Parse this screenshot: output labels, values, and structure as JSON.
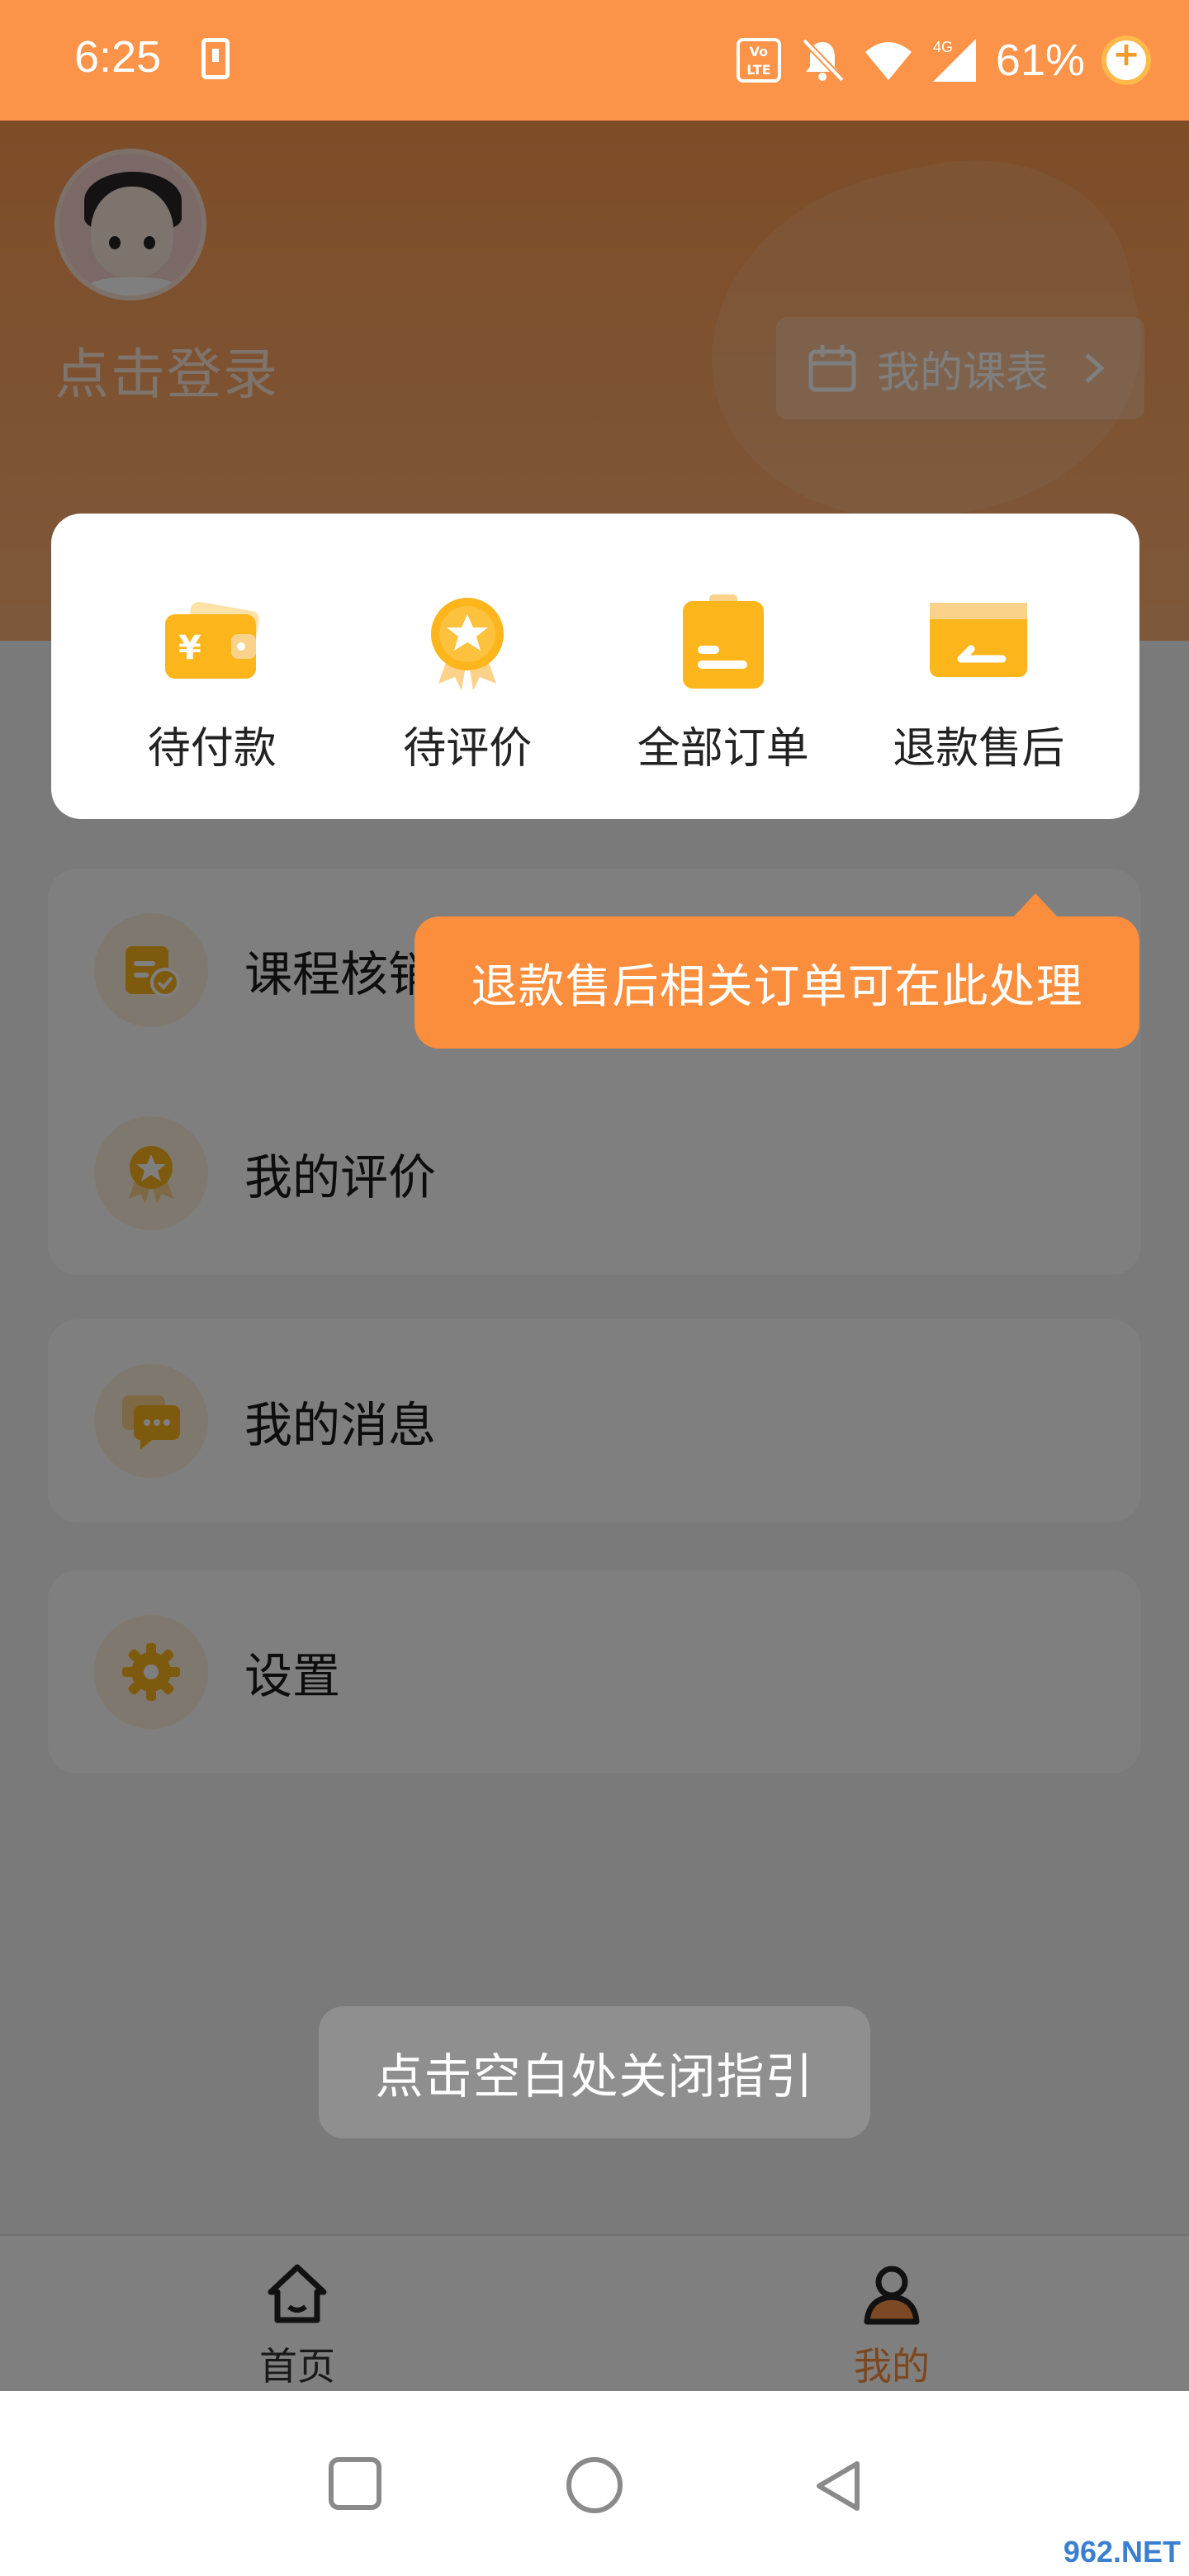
{
  "status_bar": {
    "time": "6:25",
    "volte": "VoLTE",
    "network": "4G",
    "battery": "61%"
  },
  "header": {
    "login_text": "点击登录",
    "schedule_label": "我的课表"
  },
  "orders": [
    {
      "label": "待付款",
      "icon": "wallet-icon"
    },
    {
      "label": "待评价",
      "icon": "medal-icon"
    },
    {
      "label": "全部订单",
      "icon": "clipboard-icon"
    },
    {
      "label": "退款售后",
      "icon": "card-refund-icon"
    }
  ],
  "menu": {
    "course_verify": "课程核销",
    "my_reviews": "我的评价",
    "my_messages": "我的消息",
    "settings": "设置"
  },
  "guide": {
    "tooltip": "退款售后相关订单可在此处理",
    "close_hint": "点击空白处关闭指引"
  },
  "tabs": [
    {
      "label": "首页",
      "icon": "home-icon",
      "active": false
    },
    {
      "label": "我的",
      "icon": "person-icon",
      "active": true
    }
  ],
  "colors": {
    "brand": "#fb9349",
    "accent_text": "#fb8e3d",
    "icon_gold": "#fdb51c"
  },
  "watermark": "962.NET"
}
